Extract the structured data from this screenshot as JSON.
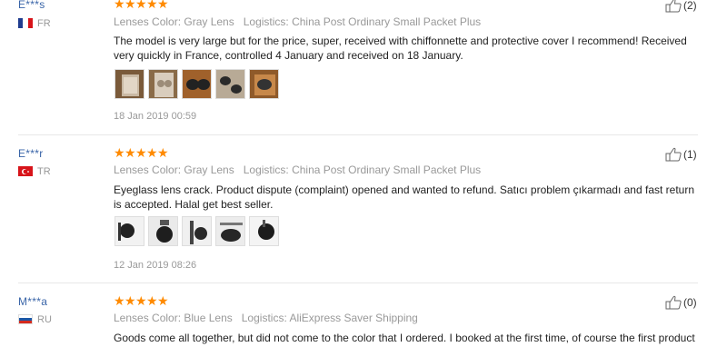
{
  "reviews": [
    {
      "buyer": "E***s",
      "country_code": "FR",
      "flag": "france-flag",
      "stars": 5,
      "meta_color": "Lenses Color: Gray Lens",
      "meta_logistics": "Logistics: China Post Ordinary Small Packet Plus",
      "text": "The model is very large but for the price, super, received with chiffonnette and protective cover I recommend! Received very quickly in France, controlled 4 January and received on 18 January.",
      "date": "18 Jan 2019 00:59",
      "helpful": "(2)"
    },
    {
      "buyer": "E***r",
      "country_code": "TR",
      "flag": "turkey-flag",
      "stars": 5,
      "meta_color": "Lenses Color: Gray Lens",
      "meta_logistics": "Logistics: China Post Ordinary Small Packet Plus",
      "text": "Eyeglass lens crack. Product dispute (complaint) opened and wanted to refund. Satıcı problem çıkarmadı and fast return is accepted. Halal get best seller.",
      "date": "12 Jan 2019 08:26",
      "helpful": "(1)"
    },
    {
      "buyer": "M***a",
      "country_code": "RU",
      "flag": "russia-flag",
      "stars": 5,
      "meta_color": "Lenses Color: Blue Lens",
      "meta_logistics": "Logistics: AliExpress Saver Shipping",
      "text": "Goods come all together, but did not come to the color that I ordered. I booked at the first time, of course the first product",
      "helpful": "(0)"
    }
  ],
  "colors": {
    "star": "#ff8a00",
    "buyer_link": "#3a65a8",
    "muted": "#999999"
  },
  "icons": {
    "helpful": "thumbs-up-icon",
    "star": "star-icon"
  }
}
